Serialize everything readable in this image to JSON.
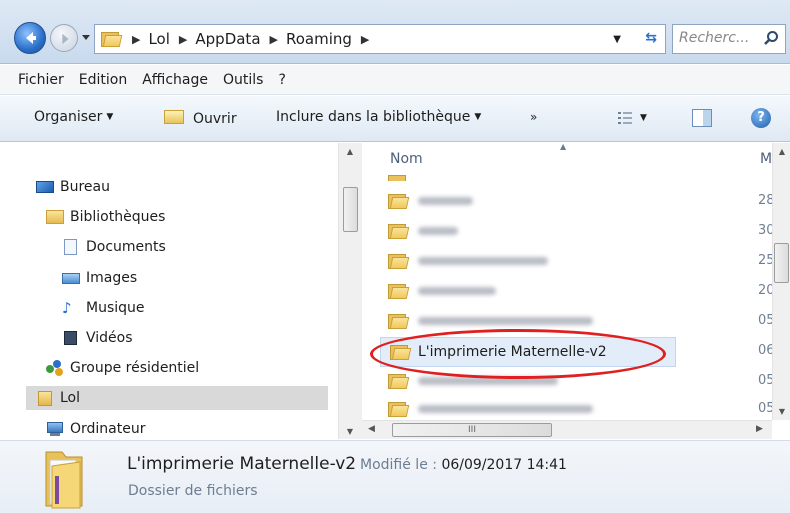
{
  "address": {
    "crumbs": [
      "Lol",
      "AppData",
      "Roaming"
    ],
    "search_placeholder": "Recherc..."
  },
  "menu": [
    "Fichier",
    "Edition",
    "Affichage",
    "Outils",
    "?"
  ],
  "toolbar": {
    "organise": "Organiser",
    "open": "Ouvrir",
    "include": "Inclure dans la bibliothèque",
    "more": "»"
  },
  "nav": {
    "items": [
      {
        "label": "Bureau",
        "icon": "desktop-icon"
      },
      {
        "label": "Bibliothèques",
        "icon": "libraries-icon"
      },
      {
        "label": "Documents",
        "icon": "documents-icon"
      },
      {
        "label": "Images",
        "icon": "images-icon"
      },
      {
        "label": "Musique",
        "icon": "music-icon"
      },
      {
        "label": "Vidéos",
        "icon": "videos-icon"
      },
      {
        "label": "Groupe résidentiel",
        "icon": "homegroup-icon"
      },
      {
        "label": "Lol",
        "icon": "user-folder-icon"
      },
      {
        "label": "Ordinateur",
        "icon": "computer-icon"
      }
    ]
  },
  "files": {
    "column_name": "Nom",
    "column_modified_cut": "M",
    "rows": [
      {
        "name": "",
        "date_cut": "28"
      },
      {
        "name": "",
        "date_cut": "30"
      },
      {
        "name": "",
        "date_cut": "25"
      },
      {
        "name": "",
        "date_cut": "20"
      },
      {
        "name": "",
        "date_cut": "05"
      },
      {
        "name": "L'imprimerie Maternelle-v2",
        "date_cut": "06"
      },
      {
        "name": "",
        "date_cut": "05"
      },
      {
        "name": "",
        "date_cut": "05"
      }
    ],
    "hscroll_grip": "III"
  },
  "details": {
    "name": "L'imprimerie Maternelle-v2",
    "modified_label": "Modifié le :",
    "modified_value": "06/09/2017 14:41",
    "type": "Dossier de fichiers"
  },
  "colors": {
    "selection_oval": "#e02020",
    "selected_row": "#e3edf9",
    "nav_selected": "#d9d9d9",
    "header_text": "#4c607a"
  }
}
